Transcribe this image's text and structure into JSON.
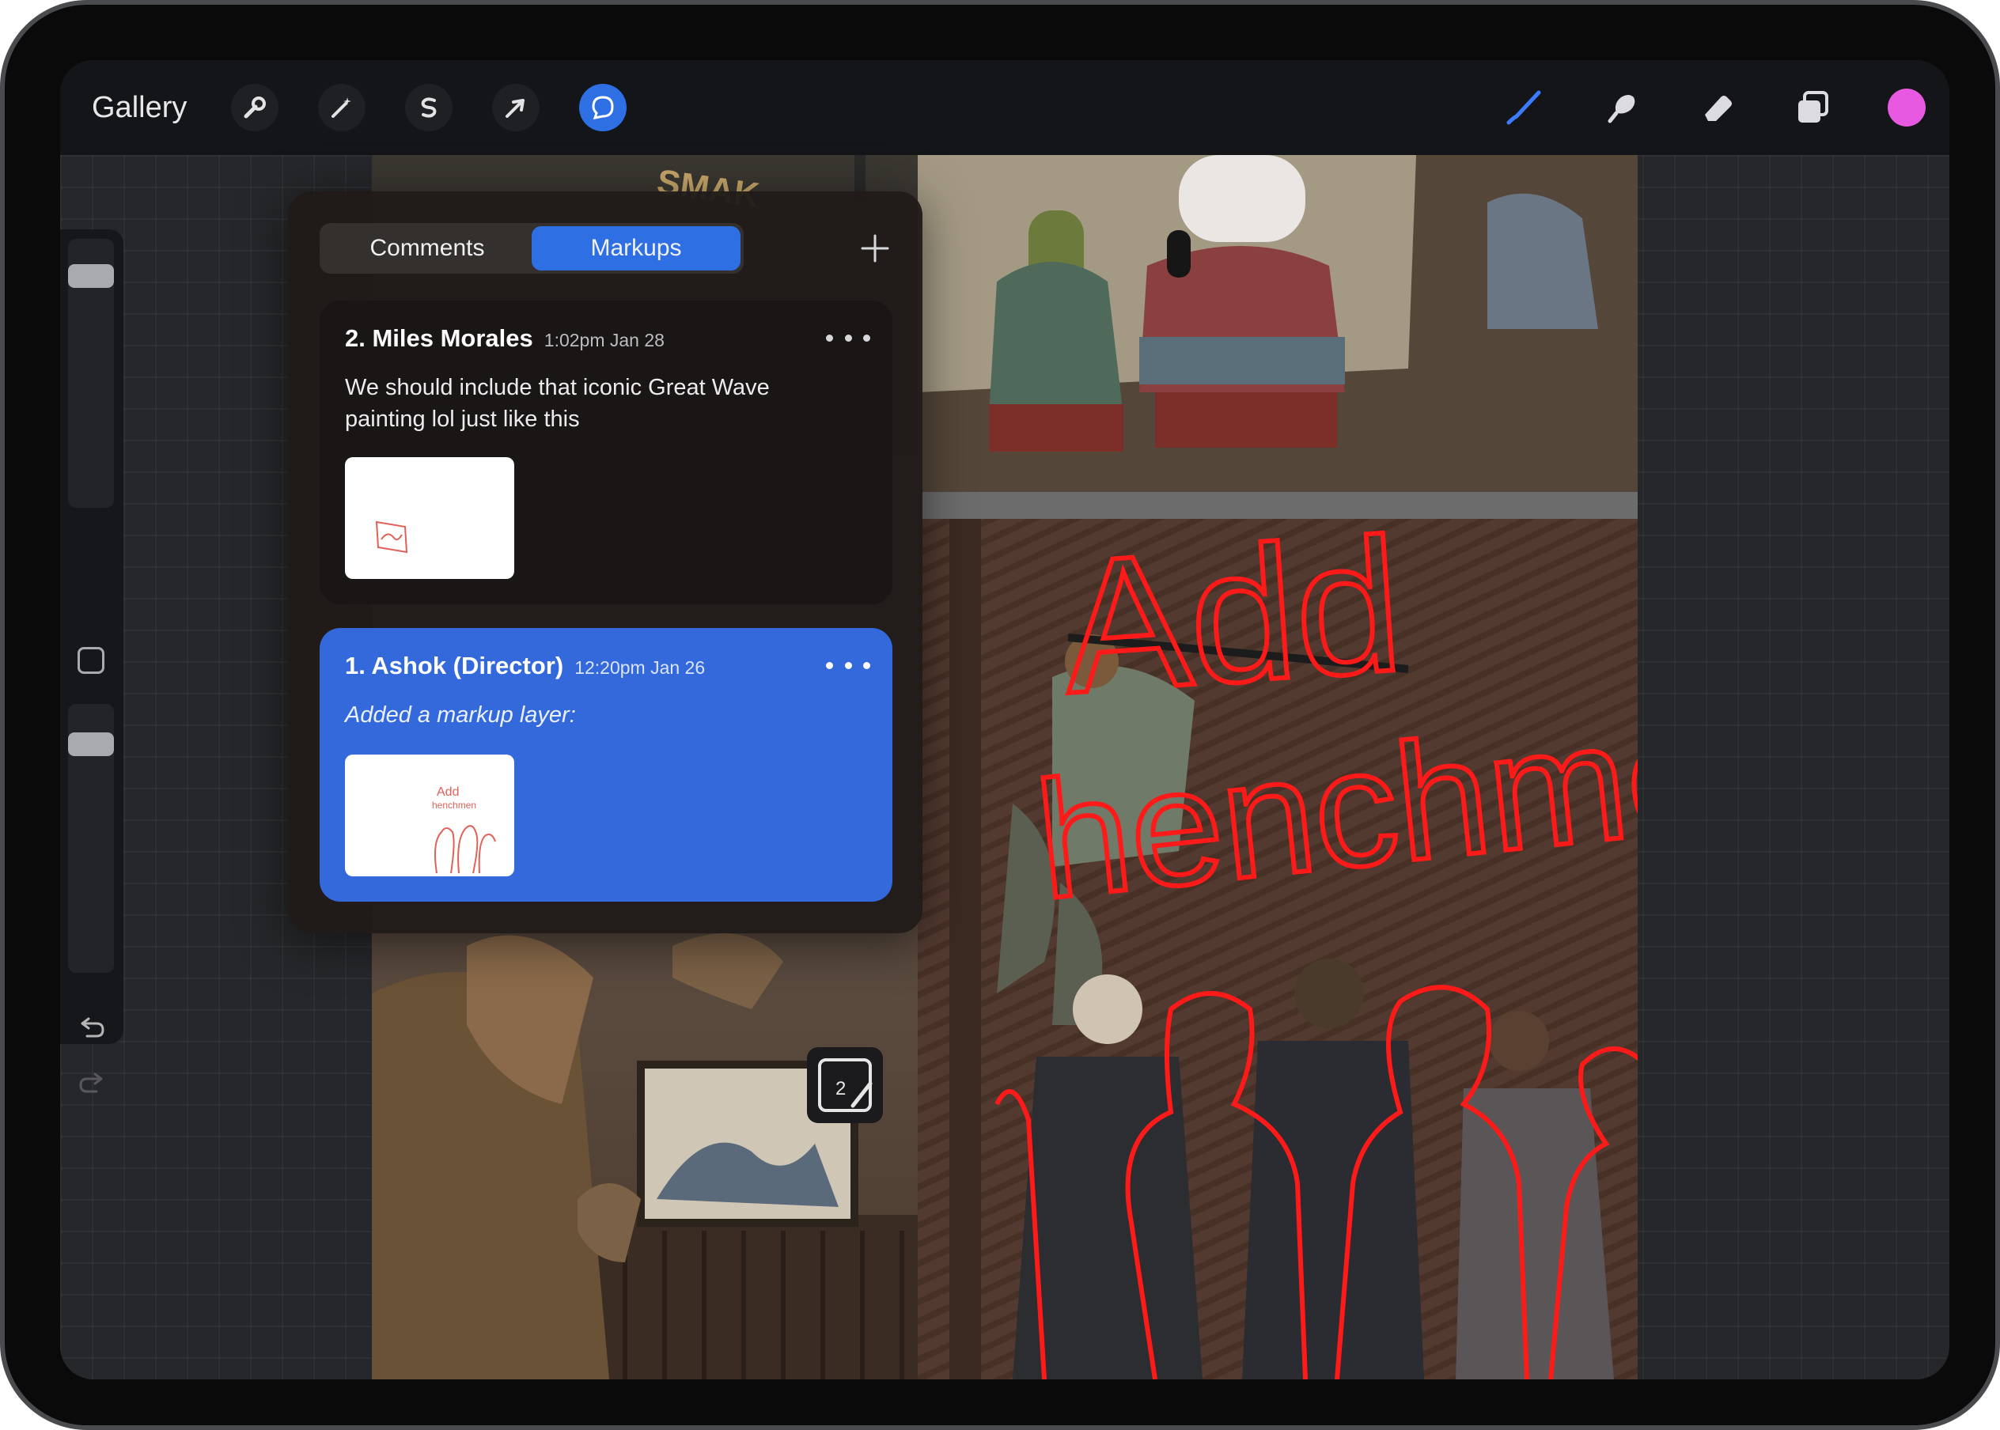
{
  "toolbar": {
    "gallery_label": "Gallery",
    "left_tools": [
      "wrench-icon",
      "magic-wand-icon",
      "selection-s-icon",
      "transform-arrow-icon",
      "comments-bubble-icon"
    ],
    "right_tools": [
      "brush-icon",
      "smudge-icon",
      "eraser-icon",
      "layers-icon"
    ],
    "active_color": "#e759e0",
    "accent_color": "#2f6fe4"
  },
  "popover": {
    "tabs": [
      {
        "label": "Comments",
        "active": false
      },
      {
        "label": "Markups",
        "active": true
      }
    ],
    "comments": [
      {
        "author": "2. Miles Morales",
        "time": "1:02pm Jan 28",
        "text": "We should include that iconic Great Wave painting lol just like this",
        "selected": false
      },
      {
        "author": "1. Ashok (Director)",
        "time": "12:20pm Jan 26",
        "text": "Added a markup layer:",
        "selected": true
      }
    ]
  },
  "canvas": {
    "markup_text_line1": "Add",
    "markup_text_line2": "henchmen",
    "markup_color": "#ff1a1a",
    "markup_tag_number": "2",
    "comic_sign": "SMAK"
  },
  "thumbnail_text": [
    "Add",
    "henchmen"
  ]
}
